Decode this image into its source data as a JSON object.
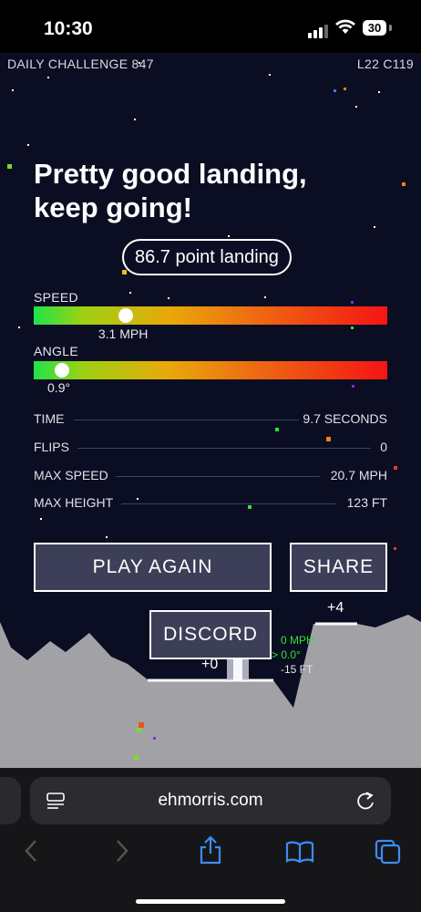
{
  "status_bar": {
    "time": "10:30",
    "battery": "30"
  },
  "game": {
    "challenge_label": "DAILY CHALLENGE 847",
    "level_code": "L22 C119",
    "headline_line1": "Pretty good landing,",
    "headline_line2": "keep going!",
    "score_pill": "86.7 point landing",
    "speed": {
      "label": "SPEED",
      "value": "3.1 MPH",
      "fraction": 0.26
    },
    "angle": {
      "label": "ANGLE",
      "value": "0.9°",
      "fraction": 0.08
    },
    "stats": [
      {
        "label": "TIME",
        "value": "9.7 SECONDS"
      },
      {
        "label": "FLIPS",
        "value": "0"
      },
      {
        "label": "MAX SPEED",
        "value": "20.7 MPH"
      },
      {
        "label": "MAX HEIGHT",
        "value": "123 FT"
      }
    ],
    "buttons": {
      "play_again": "PLAY AGAIN",
      "share": "SHARE",
      "discord": "DISCORD"
    },
    "pads": {
      "left_bonus": "+0",
      "right_bonus": "+4"
    },
    "telemetry": {
      "speed": "0 MPH",
      "angle": "0.0°",
      "altitude": "-15 FT"
    },
    "colors": {
      "terrain": "#a2a2a6",
      "background": "#0b0e22",
      "telemetry_green": "#2ee62e"
    }
  },
  "browser": {
    "url": "ehmorris.com"
  },
  "icons": [
    "signal-icon",
    "wifi-icon",
    "battery-icon",
    "reader-mode-icon",
    "reload-icon",
    "back-icon",
    "forward-icon",
    "share-icon",
    "bookmarks-icon",
    "tabs-icon"
  ]
}
